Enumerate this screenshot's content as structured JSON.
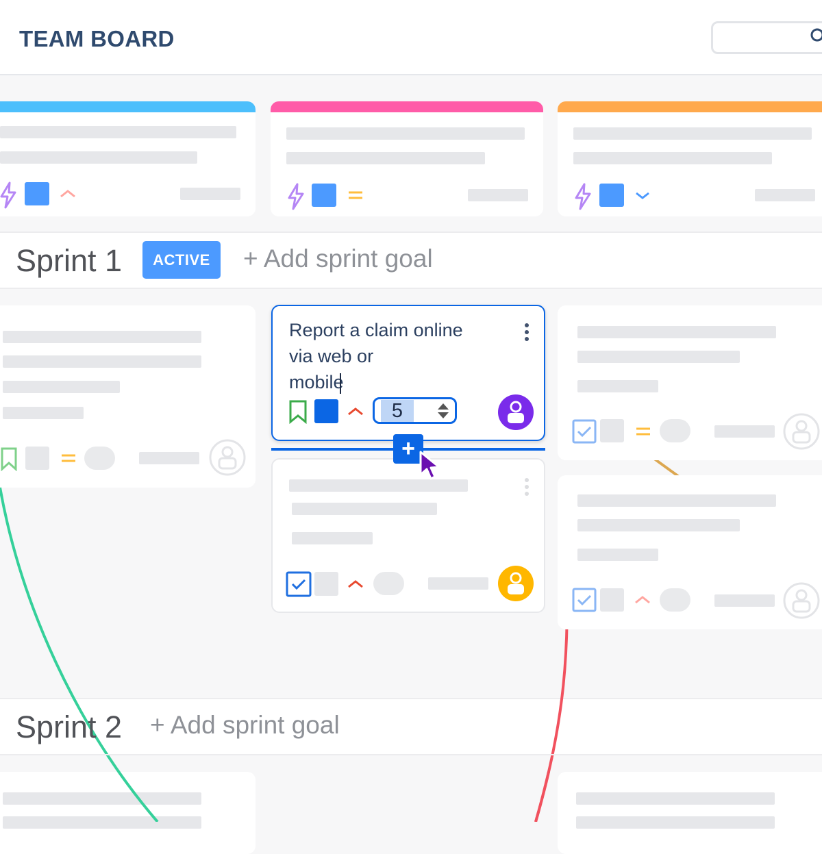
{
  "header": {
    "title": "TEAM BOARD",
    "search_icon": "search-icon"
  },
  "colors": {
    "column_1": "#4cbffc",
    "column_2": "#ff5ca8",
    "column_3": "#ffa94d",
    "accent": "#0b66e4",
    "active_badge": "#4c9aff"
  },
  "sprints": [
    {
      "title": "Sprint 1",
      "status_badge": "ACTIVE",
      "goal_link": "+ Add sprint goal"
    },
    {
      "title": "Sprint 2",
      "goal_link": "+ Add sprint goal"
    }
  ],
  "editing_card": {
    "text_line_1": "Report a claim online",
    "text_line_2": "via web or mobile",
    "story_points": "5",
    "add_button": "+",
    "icons": [
      "bookmark-icon",
      "chevron-up-icon",
      "avatar-icon",
      "more-icon"
    ]
  }
}
